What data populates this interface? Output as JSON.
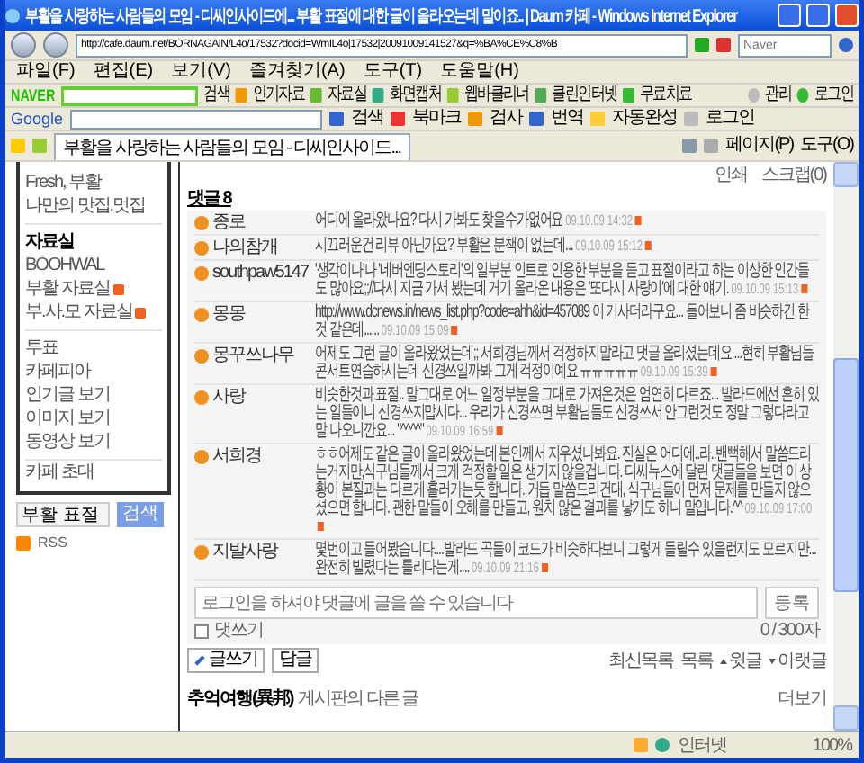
{
  "window": {
    "title": "부활을 사랑하는 사람들의 모임 - 디씨인사이드에... 부활 표절에 대한 글이 올라오는데 말이죠.. | Daum 카페 - Windows Internet Explorer"
  },
  "address_bar": {
    "url": "http://cafe.daum.net/BORNAGAIN/L4o/17532?docid=WmIL4o|17532|20091009141527&q=%BA%CE%C8%B",
    "search_placeholder": "Naver"
  },
  "menu": [
    "파일(F)",
    "편집(E)",
    "보기(V)",
    "즐겨찾기(A)",
    "도구(T)",
    "도움말(H)"
  ],
  "naver_toolbar": {
    "logo": "NAVER",
    "search": "검색",
    "items": [
      "인기자료",
      "자료실",
      "화면캡처",
      "웹바클리너",
      "클린인터넷",
      "무료치료"
    ],
    "right": [
      "관리",
      "로그인"
    ]
  },
  "google_toolbar": {
    "logo": "Google",
    "items": [
      "검색",
      "북마크",
      "검사",
      "번역",
      "자동완성",
      "로그인"
    ]
  },
  "tab": {
    "label": "부활을 사랑하는 사람들의 모임 - 디씨인사이드...",
    "selected": true
  },
  "command_bar": [
    "페이지(P)",
    "도구(O)"
  ],
  "sidebar": {
    "top_items": [
      "Fresh, 부활",
      "나만의 맛집.멋집"
    ],
    "section_title": "자료실",
    "boards": [
      {
        "label": "BOOHWAL",
        "new": false
      },
      {
        "label": "부활 자료실",
        "new": true
      },
      {
        "label": "부.사.모 자료실",
        "new": true
      }
    ],
    "links": [
      "투표",
      "카페피아",
      "인기글 보기",
      "이미지 보기",
      "동영상 보기"
    ],
    "invite": "카페 초대",
    "search_value": "부활 표절",
    "search_button": "검색",
    "rss": "RSS"
  },
  "post": {
    "actions": [
      "인쇄",
      "스크랩(0)"
    ],
    "comments_title": "댓글 8",
    "comments": [
      {
        "author": "종로",
        "text": "어디에 올라왔나요? 다시 가봐도 찾을수가없어요",
        "time": "09.10.09 14:32"
      },
      {
        "author": "나의참개",
        "text": "시끄러운건 리뷰 아닌가요? 부활은 분책이 없는데...",
        "time": "09.10.09 15:12"
      },
      {
        "author": "southpaw5147",
        "text": "'생각이나'나 '네버엔딩스토리'의 일부분 인트로 인용한 부분을 듣고 표절이라고 하는 이상한 인간들도 많아요;;//다시 지금 가서 봤는데 거기 올라온 내용은 '또다시 사랑이'에 대한 얘기.",
        "time": "09.10.09 15:13"
      },
      {
        "author": "몽몽",
        "text": "http://www.dcnews.in/news_list.php?code=ahh&id=457089 이 기사더라구요... 들어보니 좀 비슷하긴 한 것 같은데......",
        "time": "09.10.09 15:09"
      },
      {
        "author": "몽꾸쓰나무",
        "text": "어제도 그런 글이 올라왔었는데;; 서희경님께서 걱정하지말라고 댓글 올리셨는데요 ...현히 부활님들 콘서트연습하시는데 신경쓰일까봐 그게 걱정이예요 ㅠㅠㅠㅠㅠ",
        "time": "09.10.09 15:39"
      },
      {
        "author": "사랑",
        "text": "비슷한것과 표절.. 말그대로 어느 일정부분을 그대로 가져온것은 엄연히 다르죠... 발라드에선 흔히 있는 일들이니 신경쓰지맙시다... 우리가 신경쓰면 부활님들도 신경쓰서 안그런것도 정말 그렇다라고 말 나오니깐요... \"^^^^\"",
        "time": "09.10.09 16:59"
      },
      {
        "author": "서희경",
        "text": "ㅎㅎ어제도 같은 글이 올라왔었는데 본인께서 지우셨나봐요. 진실은 어디에..라..밴뻑해서 말씀드리는거지만,식구님들께서 크게 걱정할 일은 생기지 않을겁니다. 디씨뉴스에 달린 댓글들을 보면 이 상황이 본질과는 다르게 흘러가는듯 합니다. 거듭 말씀드리건대, 식구님들이 먼저 문제를 만들지 않으셨으면 합니다. 괜한 말들이 오해를 만들고, 원치 않은 결과를 낳기도 하니 말입니다.^^",
        "time": "09.10.09 17:00"
      },
      {
        "author": "지발사랑",
        "text": "몇번이고 들어봤습니다....발라드 곡들이 코드가 비슷하다보니 그렇게 들릴수 있을런지도 모르지만...완전히 빌렸다는 틀리다는게....",
        "time": "09.10.09 21:16"
      }
    ],
    "reply": {
      "placeholder": "로그인을 하셔야 댓글에 글을 쓸 수 있습니다",
      "checkbox_label": "댓쓰기",
      "checked": false,
      "counter": "0 / 300자",
      "submit": "등록"
    },
    "buttons": [
      "글쓰기",
      "답글"
    ],
    "nav": [
      "최신목록",
      "목록",
      "윗글",
      "아랫글"
    ]
  },
  "other_posts": {
    "board": "추억여행(異邦)",
    "label": "게시판의 다른 글",
    "more": "더보기"
  },
  "status_bar": {
    "zone": "인터넷",
    "zoom": "100%"
  }
}
